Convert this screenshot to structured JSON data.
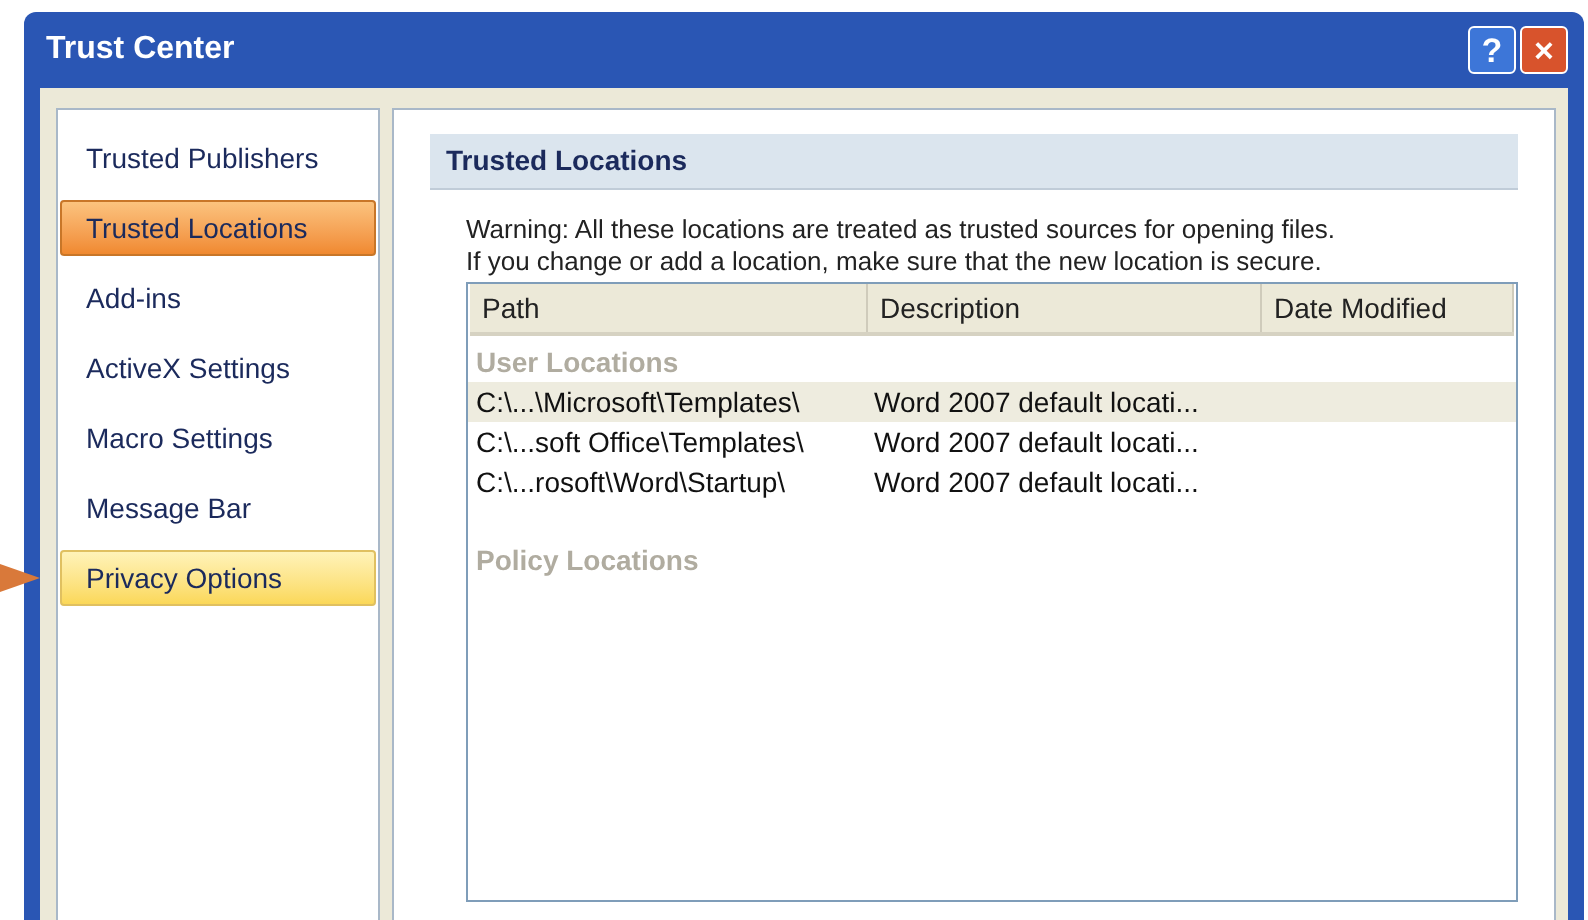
{
  "window": {
    "title": "Trust Center",
    "buttons": [
      {
        "kind": "help",
        "label": "?"
      },
      {
        "kind": "close",
        "label": "×"
      }
    ]
  },
  "sidebar": {
    "items": [
      {
        "label": "Trusted Publishers",
        "selected": false,
        "hovered": false
      },
      {
        "label": "Trusted Locations",
        "selected": true,
        "hovered": false
      },
      {
        "label": "Add-ins",
        "selected": false,
        "hovered": false
      },
      {
        "label": "ActiveX Settings",
        "selected": false,
        "hovered": false
      },
      {
        "label": "Macro Settings",
        "selected": false,
        "hovered": false
      },
      {
        "label": "Message Bar",
        "selected": false,
        "hovered": false
      },
      {
        "label": "Privacy Options",
        "selected": false,
        "hovered": true
      }
    ]
  },
  "panel": {
    "title": "Trusted Locations",
    "warning": [
      "Warning: All these locations are treated as trusted sources for opening files.",
      "If you change or add a location, make sure that the new location is secure."
    ],
    "table": {
      "columns": [
        "Path",
        "Description",
        "Date Modified"
      ],
      "rows": [
        {
          "kind": "group",
          "label": "User Locations"
        },
        {
          "kind": "item",
          "selected": true,
          "cells": [
            "C:\\...\\Microsoft\\Templates\\",
            "Word 2007 default locati..."
          ]
        },
        {
          "kind": "item",
          "selected": false,
          "cells": [
            "C:\\...soft Office\\Templates\\",
            "Word 2007 default locati..."
          ]
        },
        {
          "kind": "item",
          "selected": false,
          "cells": [
            "C:\\...rosoft\\Word\\Startup\\",
            "Word 2007 default locati..."
          ]
        },
        {
          "kind": "group",
          "label": "Policy Locations"
        }
      ]
    }
  }
}
